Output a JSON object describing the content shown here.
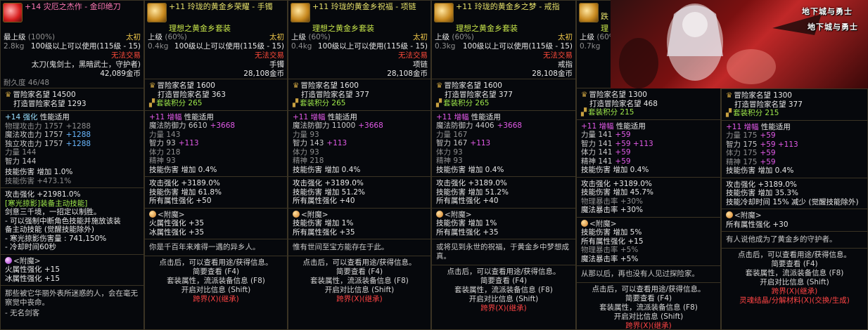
{
  "tips": [
    {
      "name": "+14 灾厄之杰作 - 金印绝刀",
      "grade": "最上级",
      "grade_pct": "(100%)",
      "type": "太初",
      "weight": "2.8kg",
      "level_req": "100级以上可以使用(115级 - 15)",
      "tradable": "无法交易",
      "classes": "太刀(鬼剑士，黑暗武士，守护者)",
      "price": "42,089金币",
      "durability": "耐久度 46/48",
      "fame": "冒险家名望 14500",
      "forge_fame": "打造冒险家名望 1293",
      "reinforce": "+14 强化",
      "reinforce_label": "性能适用",
      "stats": [
        {
          "k": "物理攻击力",
          "v": "1757",
          "b": "+1288",
          "dim": true
        },
        {
          "k": "魔法攻击力",
          "v": "1757",
          "b": "+1288",
          "dim": false
        },
        {
          "k": "独立攻击力",
          "v": "1757",
          "b": "+1288",
          "dim": false
        },
        {
          "k": "力量",
          "v": "144",
          "b": "",
          "dim": true
        },
        {
          "k": "智力",
          "v": "144",
          "b": "",
          "dim": false
        }
      ],
      "skill_dmg": "技能伤害  增加 1.0%",
      "skill_dmg_extra": "技能伤害 +473.1%",
      "atk_up": "攻击强化 +21981.0%",
      "skill_title": "[寒光掠影]装备主动技能]",
      "skill_lines": [
        "剑意三千境，一招定以制胜。",
        "- 可以强制中断角色技能并施放该装",
        "备主动技能 (觉醒技能除外)",
        "- 寒光掠影伤害量 : 741,150%",
        "- 冷却时间60秒"
      ],
      "enchant_title": "<附魔>",
      "enchant": [
        "火属性强化 +15",
        "冰属性强化 +15"
      ],
      "desc": "那些被它华丽外表所迷惑的人，会在毫无察觉中丧命。",
      "desc2": "- 无名剑客"
    },
    {
      "name": "+11 玲珑的黄金乡荣耀 - 手镯",
      "set": "理想之黄金乡套装",
      "grade": "上级",
      "grade_pct": "(60%)",
      "type": "太初",
      "weight": "0.4kg",
      "level_req": "100级以上可以使用(115级 - 15)",
      "tradable": "无法交易",
      "slot": "手镯",
      "price": "28,108金币",
      "fame": "冒险家名望 1600",
      "forge_fame": "打造冒险家名望 363",
      "set_pts": "套装积分 265",
      "amp": "+11 增幅",
      "amp_label": "性能适用",
      "stats": [
        {
          "k": "魔法防御力",
          "v": "6610",
          "b": "+3668",
          "dim": false
        },
        {
          "k": "力量",
          "v": "143",
          "b": "",
          "dim": true
        },
        {
          "k": "智力",
          "v": "93",
          "b": "+113",
          "dim": false
        },
        {
          "k": "体力",
          "v": "218",
          "b": "",
          "dim": true
        },
        {
          "k": "精神",
          "v": "93",
          "b": "",
          "dim": true
        }
      ],
      "skill_dmg": "技能伤害  增加 0.4%",
      "atk_up": "攻击强化 +3189.0%",
      "skill_dmg2": "技能伤害 增加 61.8%",
      "all_elem": "所有属性强化 +50",
      "enchant_title": "<附魔>",
      "enchant": [
        "火属性强化 +35",
        "冰属性强化 +35"
      ],
      "desc": "你是千百年来难得一遇的异乡人。",
      "hint": [
        "点击后，可以查看用途/获得信息。",
        "简要查看 (F4)",
        "套装属性，流派装备信息 (F8)",
        "开启对比信息 (Shift)"
      ],
      "cross": "跨界(X)(继承)"
    },
    {
      "name": "+11 玲珑的黄金乡祝福 - 项链",
      "set": "理想之黄金乡套装",
      "grade": "上级",
      "grade_pct": "(60%)",
      "type": "太初",
      "weight": "0.4kg",
      "level_req": "100级以上可以使用(115级 - 15)",
      "tradable": "无法交易",
      "slot": "项链",
      "price": "28,108金币",
      "fame": "冒险家名望 1600",
      "forge_fame": "打造冒险家名望 377",
      "set_pts": "套装积分 265",
      "amp": "+11 增幅",
      "amp_label": "性能适用",
      "stats": [
        {
          "k": "魔法防御力",
          "v": "11000",
          "b": "+3668",
          "dim": false
        },
        {
          "k": "力量",
          "v": "93",
          "b": "",
          "dim": true
        },
        {
          "k": "智力",
          "v": "143",
          "b": "+113",
          "dim": false
        },
        {
          "k": "体力",
          "v": "93",
          "b": "",
          "dim": true
        },
        {
          "k": "精神",
          "v": "218",
          "b": "",
          "dim": true
        }
      ],
      "skill_dmg": "技能伤害  增加 0.4%",
      "atk_up": "攻击强化 +3189.0%",
      "skill_dmg2": "技能伤害 增加 51.2%",
      "all_elem": "所有属性强化 +40",
      "enchant_title": "<附魔>",
      "enchant": [
        "技能伤害 增加 1%",
        "所有属性强化 +35"
      ],
      "desc": "惟有世间至宝方能存在于此。",
      "hint": [
        "点击后，可以查看用途/获得信息。",
        "简要查看 (F4)",
        "套装属性，流派装备信息 (F8)",
        "开启对比信息 (Shift)"
      ],
      "cross": "跨界(X)(继承)"
    },
    {
      "name": "+11 玲珑的黄金乡之梦 - 戒指",
      "set": "理想之黄金乡套装",
      "grade": "上级",
      "grade_pct": "(60%)",
      "type": "太初",
      "weight": "0.3kg",
      "level_req": "100级以上可以使用(115级 - 15)",
      "tradable": "无法交易",
      "slot": "戒指",
      "price": "28,108金币",
      "fame": "冒险家名望 1600",
      "forge_fame": "打造冒险家名望 377",
      "set_pts": "套装积分 265",
      "amp": "+11 增幅",
      "amp_label": "性能适用",
      "stats": [
        {
          "k": "魔法防御力",
          "v": "4406",
          "b": "+3668",
          "dim": false
        },
        {
          "k": "力量",
          "v": "167",
          "b": "",
          "dim": true
        },
        {
          "k": "智力",
          "v": "167",
          "b": "+113",
          "dim": false
        },
        {
          "k": "体力",
          "v": "93",
          "b": "",
          "dim": true
        },
        {
          "k": "精神",
          "v": "93",
          "b": "",
          "dim": true
        }
      ],
      "skill_dmg": "技能伤害  增加 0.4%",
      "atk_up": "攻击强化 +3189.0%",
      "skill_dmg2": "技能伤害 增加 51.2%",
      "all_elem": "所有属性强化 +40",
      "enchant_title": "<附魔>",
      "enchant": [
        "技能伤害 增加 1%",
        "所有属性强化 +35"
      ],
      "desc": "或将见到永世的祝福，于黄金乡中梦想成真。",
      "hint": [
        "点击后，可以查看用途/获得信息。",
        "简要查看 (F4)",
        "套装属性，流派装备信息 (F8)",
        "开启对比信息 (Shift)"
      ],
      "cross": "跨界(X)(继承)"
    },
    {
      "name_short": "跌",
      "name_short2": "理",
      "grade": "上级",
      "grade_pct": "(60%)",
      "weight": "0.7kg",
      "fame": "冒险家名望 1300",
      "forge_fame": "打造冒险家名望 468",
      "set_pts": "套装积分 215",
      "amp": "+11 增幅",
      "amp_label": "性能适用",
      "stats": [
        {
          "k": "力量",
          "v": "141",
          "b": "+59",
          "dim": false
        },
        {
          "k": "智力",
          "v": "141",
          "b": "+59 +113",
          "dim": false
        },
        {
          "k": "体力",
          "v": "141",
          "b": "+59",
          "dim": false
        },
        {
          "k": "精神",
          "v": "141",
          "b": "+59",
          "dim": false
        }
      ],
      "skill_dmg": "技能伤害  增加 0.4%",
      "atk_up": "攻击强化 +3189.0%",
      "skill_dmg2": "技能伤害 增加 45.7%",
      "crit_phys": "物理暴击率 +30%",
      "crit_mag": "魔法暴击率 +30%",
      "enchant_title": "<附魔>",
      "enchant": [
        "技能伤害 增加 5%",
        "所有属性强化 +15",
        "物理暴击率 +5%",
        "魔法暴击率 +5%"
      ],
      "desc": "从那以后，再也没有人见过探险家。",
      "hint": [
        "点击后，可以查看用途/获得信息。",
        "简要查看 (F4)",
        "套装属性，流派装备信息 (F8)",
        "开启对比信息 (Shift)"
      ],
      "cross": "跨界(X)(继承)"
    },
    {
      "fame": "冒险家名望 1300",
      "forge_fame": "打造冒险家名望 377",
      "set_pts": "套装积分 215",
      "amp": "+11 增幅",
      "amp_label": "性能适用",
      "stats": [
        {
          "k": "力量",
          "v": "175",
          "b": "+59",
          "dim": false
        },
        {
          "k": "智力",
          "v": "175",
          "b": "+59 +113",
          "dim": false
        },
        {
          "k": "体力",
          "v": "175",
          "b": "+59",
          "dim": false
        },
        {
          "k": "精神",
          "v": "175",
          "b": "+59",
          "dim": false
        }
      ],
      "skill_dmg": "技能伤害  增加 0.4%",
      "atk_up": "攻击强化 +3189.0%",
      "skill_dmg2": "技能伤害 增加 35.3%",
      "cooldown": "技能冷却时间 15% 减少 (觉醒技能除外)",
      "enchant_title": "<附魔>",
      "enchant": [
        "所有属性强化 +30"
      ],
      "desc": "有人说他成为了黄金乡的守护者。",
      "hint": [
        "点击后，可以查看用途/获得信息。",
        "简要查看 (F4)",
        "套装属性，流派装备信息 (F8)",
        "开启对比信息 (Shift)"
      ],
      "cross": "跨界(X)(继承)",
      "extra": "灵魂结晶/分解材料(X)(交换/生成)"
    }
  ],
  "banner": {
    "logo1": "地下城与勇士",
    "logo2": "地下城与勇士"
  }
}
